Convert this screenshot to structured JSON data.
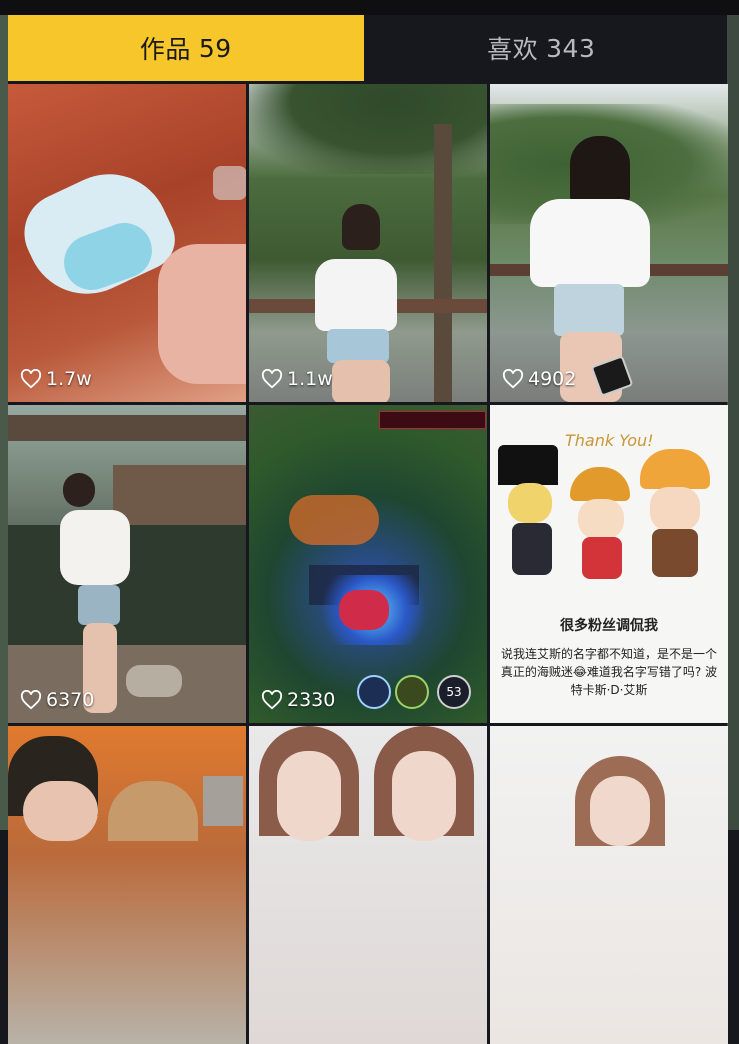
{
  "tabs": [
    {
      "label": "作品",
      "count": "59",
      "active": true
    },
    {
      "label": "喜欢",
      "count": "343",
      "active": false
    }
  ],
  "colors": {
    "active_tab": "#f7c62a",
    "background": "#17181d",
    "inactive_text": "#b9b9bf"
  },
  "icons": {
    "likes": "heart-outline-icon"
  },
  "posts": [
    {
      "likes": "1.7w"
    },
    {
      "likes": "1.1w"
    },
    {
      "likes": "4902"
    },
    {
      "likes": "6370"
    },
    {
      "likes": "2330"
    },
    {
      "likes": "",
      "art_title": "Thank You!",
      "art_line1": "很多粉丝调侃我",
      "art_line2": "说我连艾斯的名字都不知道，是不是一个真正的海贼迷😂难道我名字写错了吗? 波特卡斯·D·艾斯"
    },
    {
      "likes": ""
    },
    {
      "likes": ""
    },
    {
      "likes": ""
    }
  ],
  "game_hud": {
    "badge_number": "53"
  }
}
